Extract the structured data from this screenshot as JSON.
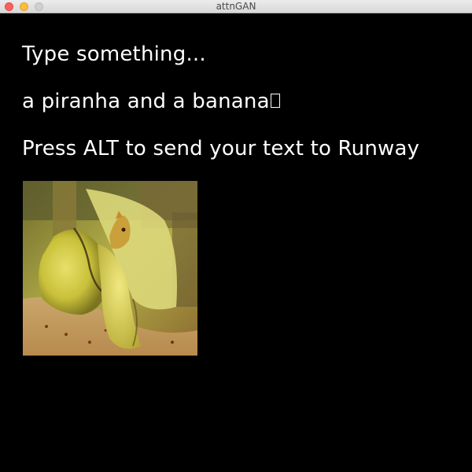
{
  "window": {
    "title": "attnGAN"
  },
  "canvas": {
    "prompt_label": "Type something...",
    "input_text": "a piranha and a banana",
    "instruction": "Press ALT to send your text to Runway"
  },
  "colors": {
    "background": "#000000",
    "text": "#ffffff",
    "close": "#fc605c",
    "minimize": "#fdbc40",
    "maximize": "#d0d0d0"
  },
  "icons": [
    "close-icon",
    "minimize-icon",
    "maximize-icon",
    "text-cursor-icon"
  ]
}
